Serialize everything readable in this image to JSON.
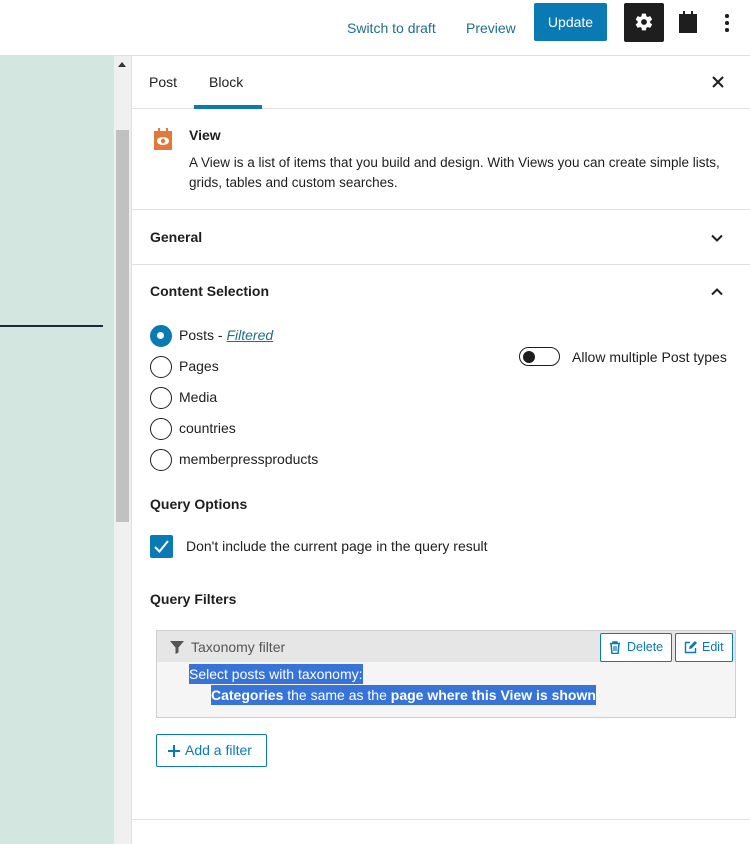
{
  "topbar": {
    "switch_to_draft": "Switch to draft",
    "preview": "Preview",
    "update": "Update",
    "settings_icon": "gear-icon",
    "plugin_icon": "toolset-block-icon",
    "more_icon": "vertical-ellipsis-icon"
  },
  "sidebar": {
    "tabs": [
      "Post",
      "Block"
    ],
    "active_tab": "Block",
    "close_icon": "close-icon"
  },
  "block": {
    "icon": "view-eye-icon",
    "title": "View",
    "description": "A View is a list of items that you build and design. With Views you can create simple lists, grids, tables and custom searches."
  },
  "panels": {
    "general": "General",
    "content_selection": "Content Selection"
  },
  "content_selection": {
    "options": [
      {
        "label": "Posts - ",
        "link": "Filtered",
        "selected": true
      },
      {
        "label": "Pages",
        "selected": false
      },
      {
        "label": "Media",
        "selected": false
      },
      {
        "label": "countries",
        "selected": false
      },
      {
        "label": "memberpressproducts",
        "selected": false
      }
    ],
    "allow_multiple": {
      "label": "Allow multiple Post types",
      "enabled": false
    }
  },
  "query_options": {
    "title": "Query Options",
    "exclude_current": {
      "label": "Don't include the current page in the query result",
      "checked": true
    }
  },
  "query_filters": {
    "title": "Query Filters",
    "filter": {
      "title": "Taxonomy filter",
      "delete": "Delete",
      "edit": "Edit",
      "line1": "Select posts with taxonomy:",
      "line2_bold1": "Categories",
      "line2_mid": " the same as the ",
      "line2_bold2": "page where this View is shown"
    },
    "add_filter": "Add a filter"
  },
  "colors": {
    "accent": "#0a7ab5",
    "selection": "#3874d8",
    "canvas": "#d3e6e0"
  }
}
